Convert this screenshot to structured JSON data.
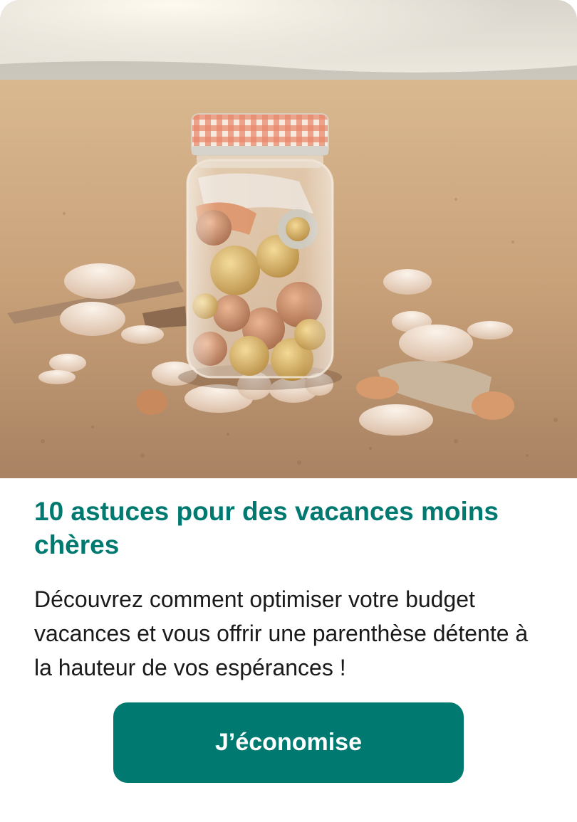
{
  "hero": {
    "image_name": "beach-savings-jar-photo",
    "colors": {
      "sea": "#e9e4da",
      "sand": "#c9a27a",
      "lid": "#e0694a",
      "coin": "#c99a45"
    }
  },
  "article": {
    "title": "10 astuces pour des vacances moins chères",
    "description": "Découvrez comment optimiser votre budget vacances et vous offrir une parenthèse détente à la hauteur de vos espérances !"
  },
  "cta": {
    "label": "J’économise",
    "color": "#007a70"
  }
}
